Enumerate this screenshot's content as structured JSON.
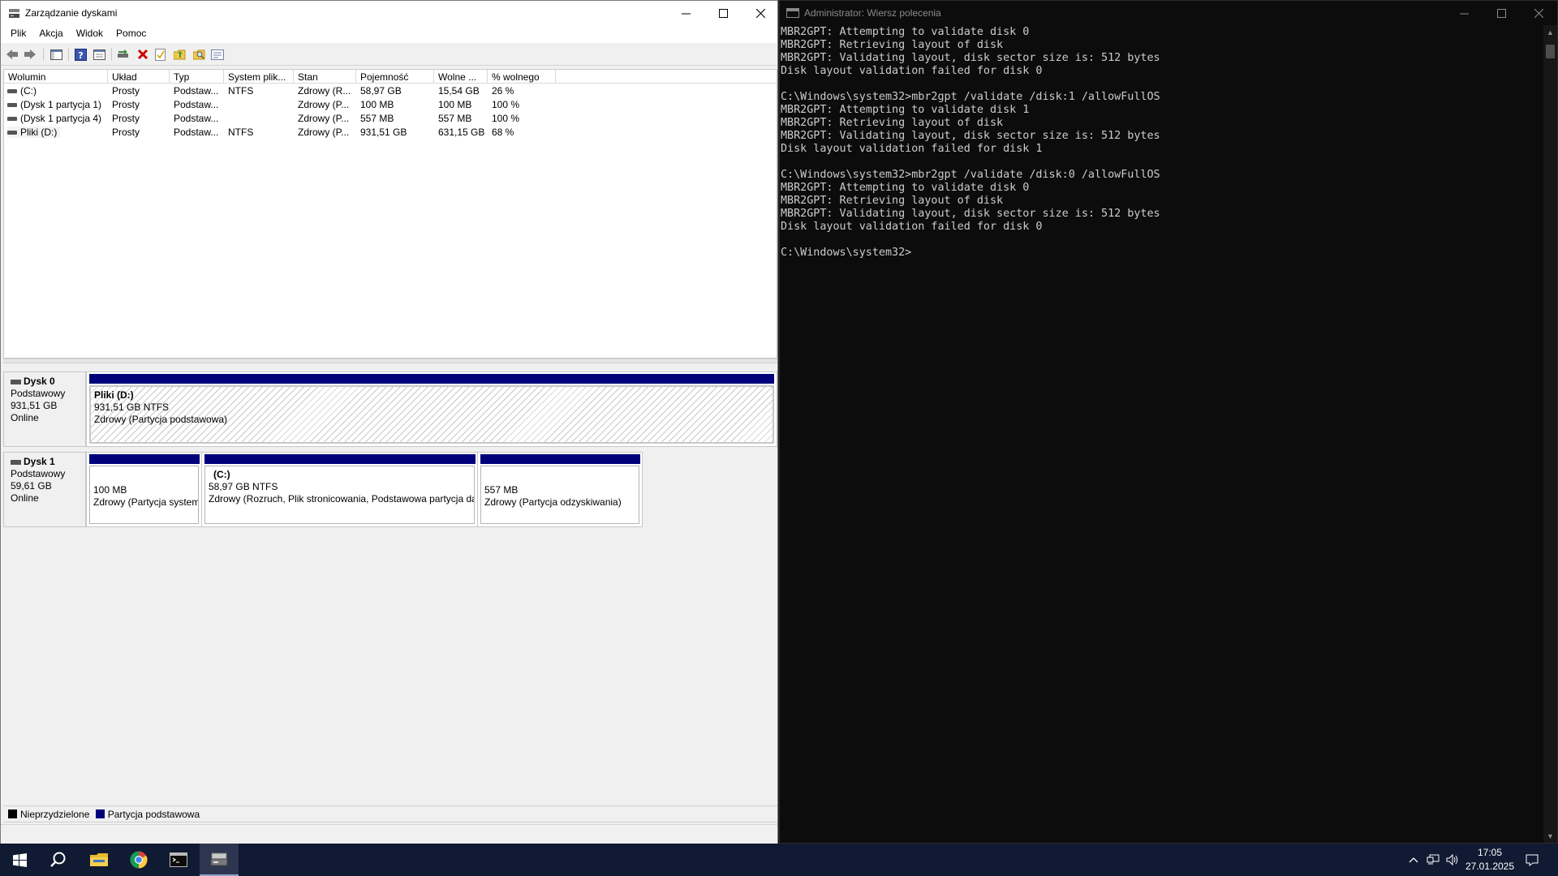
{
  "disk_management": {
    "title": "Zarządzanie dyskami",
    "menu": [
      "Plik",
      "Akcja",
      "Widok",
      "Pomoc"
    ],
    "columns": [
      "Wolumin",
      "Układ",
      "Typ",
      "System plik...",
      "Stan",
      "Pojemność",
      "Wolne ...",
      "% wolnego"
    ],
    "volumes": [
      {
        "name": "(C:)",
        "layout": "Prosty",
        "type": "Podstaw...",
        "fs": "NTFS",
        "status": "Zdrowy (R...",
        "capacity": "58,97 GB",
        "free": "15,54 GB",
        "pct": "26 %"
      },
      {
        "name": "(Dysk 1 partycja 1)",
        "layout": "Prosty",
        "type": "Podstaw...",
        "fs": "",
        "status": "Zdrowy (P...",
        "capacity": "100 MB",
        "free": "100 MB",
        "pct": "100 %"
      },
      {
        "name": "(Dysk 1 partycja 4)",
        "layout": "Prosty",
        "type": "Podstaw...",
        "fs": "",
        "status": "Zdrowy (P...",
        "capacity": "557 MB",
        "free": "557 MB",
        "pct": "100 %"
      },
      {
        "name": "Pliki (D:)",
        "layout": "Prosty",
        "type": "Podstaw...",
        "fs": "NTFS",
        "status": "Zdrowy (P...",
        "capacity": "931,51 GB",
        "free": "631,15 GB",
        "pct": "68 %"
      }
    ],
    "disks": [
      {
        "name": "Dysk 0",
        "kind": "Podstawowy",
        "size": "931,51 GB",
        "state": "Online",
        "partitions": [
          {
            "title": "Pliki  (D:)",
            "size": "931,51 GB NTFS",
            "status": "Zdrowy (Partycja podstawowa)"
          }
        ]
      },
      {
        "name": "Dysk 1",
        "kind": "Podstawowy",
        "size": "59,61 GB",
        "state": "Online",
        "partitions": [
          {
            "title": "",
            "size": "100 MB",
            "status": "Zdrowy (Partycja systemowa EFI)"
          },
          {
            "title": "(C:)",
            "size": "58,97 GB NTFS",
            "status": "Zdrowy (Rozruch, Plik stronicowania, Podstawowa partycja danych)"
          },
          {
            "title": "",
            "size": "557 MB",
            "status": "Zdrowy (Partycja odzyskiwania)"
          }
        ]
      }
    ],
    "legend": [
      "Nieprzydzielone",
      "Partycja podstawowa"
    ],
    "colors": {
      "primary_partition": "#00007b",
      "unallocated": "#000000"
    }
  },
  "cmd": {
    "title": "Administrator: Wiersz polecenia",
    "lines": [
      "MBR2GPT: Attempting to validate disk 0",
      "MBR2GPT: Retrieving layout of disk",
      "MBR2GPT: Validating layout, disk sector size is: 512 bytes",
      "Disk layout validation failed for disk 0",
      "",
      "C:\\Windows\\system32>mbr2gpt /validate /disk:1 /allowFullOS",
      "MBR2GPT: Attempting to validate disk 1",
      "MBR2GPT: Retrieving layout of disk",
      "MBR2GPT: Validating layout, disk sector size is: 512 bytes",
      "Disk layout validation failed for disk 1",
      "",
      "C:\\Windows\\system32>mbr2gpt /validate /disk:0 /allowFullOS",
      "MBR2GPT: Attempting to validate disk 0",
      "MBR2GPT: Retrieving layout of disk",
      "MBR2GPT: Validating layout, disk sector size is: 512 bytes",
      "Disk layout validation failed for disk 0",
      "",
      "C:\\Windows\\system32>"
    ]
  },
  "taskbar": {
    "apps": [
      "start-icon",
      "search-icon",
      "file-explorer-icon",
      "chrome-icon",
      "command-prompt-icon",
      "disk-management-icon"
    ],
    "time": "17:05",
    "date": "27.01.2025"
  }
}
